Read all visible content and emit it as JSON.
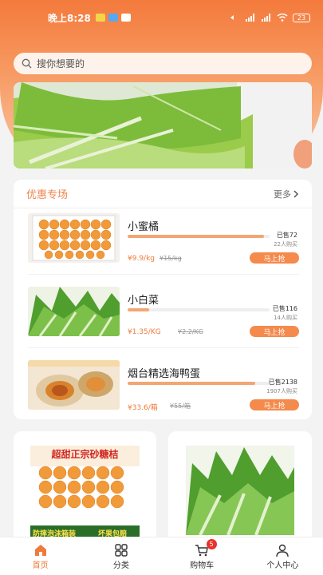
{
  "status_bar": {
    "time": "晚上8:28",
    "battery": "23"
  },
  "search": {
    "placeholder": "搜你想要的"
  },
  "promo": {
    "title": "优惠专场",
    "more_label": "更多",
    "items": [
      {
        "name": "小蜜橘",
        "sold": "已售72",
        "buyers": "22人购买",
        "price": "¥9.9/kg",
        "original_price": "¥15/kg",
        "buy_label": "马上抢",
        "progress": 0.96
      },
      {
        "name": "小白菜",
        "sold": "已售116",
        "buyers": "14人购买",
        "price": "¥1.35/KG",
        "original_price": "¥2.2/KG",
        "buy_label": "马上抢",
        "progress": 0.15
      },
      {
        "name": "烟台精选海鸭蛋",
        "sold": "已售2138",
        "buyers": "1907人购买",
        "price": "¥33.6/箱",
        "original_price": "¥55/箱",
        "buy_label": "马上抢",
        "progress": 0.9
      }
    ]
  },
  "product_cards": [
    {
      "image_text": [
        "超甜正宗砂糖桔",
        "防摔泡沫箱装",
        "坏果包赔"
      ]
    },
    {
      "image_text": []
    }
  ],
  "tabbar": {
    "items": [
      {
        "label": "首页",
        "icon": "home-icon",
        "active": true
      },
      {
        "label": "分类",
        "icon": "grid-icon",
        "active": false
      },
      {
        "label": "购物车",
        "icon": "cart-icon",
        "active": false,
        "badge": "5"
      },
      {
        "label": "个人中心",
        "icon": "person-icon",
        "active": false
      }
    ]
  },
  "colors": {
    "accent": "#f07a3a",
    "gradient_top": "#f47a3c",
    "badge": "#e8322b"
  }
}
